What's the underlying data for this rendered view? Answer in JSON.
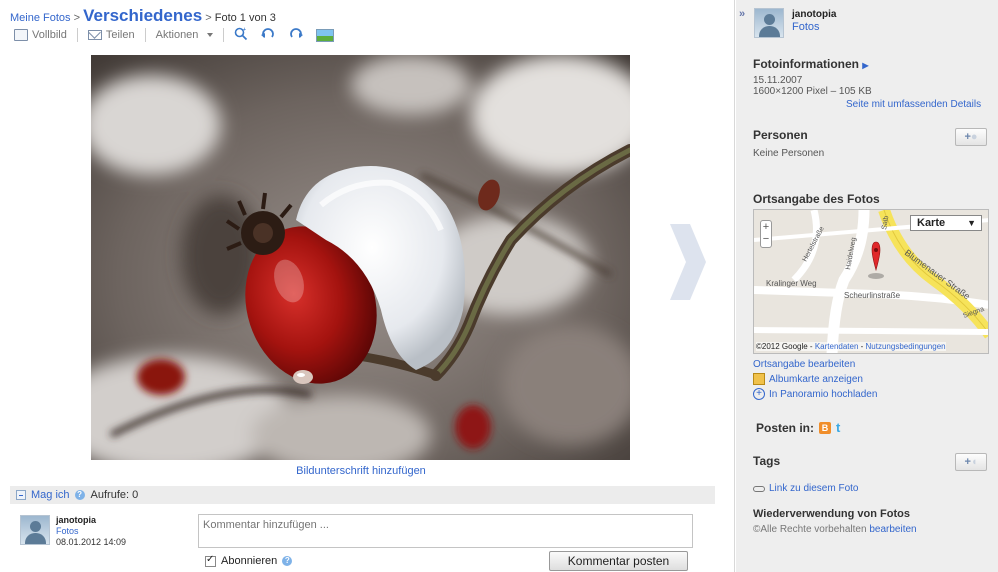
{
  "breadcrumb": {
    "root": "Meine Fotos",
    "sep1": ">",
    "album": "Verschiedenes",
    "sep2": ">",
    "position": "Foto 1 von 3"
  },
  "toolbar": {
    "fullscreen": "Vollbild",
    "share": "Teilen",
    "actions": "Aktionen"
  },
  "photo": {
    "caption_link": "Bildunterschrift hinzufügen"
  },
  "likebar": {
    "like": "Mag ich",
    "views": "Aufrufe: 0"
  },
  "comment": {
    "author": "janotopia",
    "author_link": "Fotos",
    "date": "08.01.2012 14:09",
    "placeholder": "Kommentar hinzufügen ...",
    "subscribe": "Abonnieren",
    "post_button": "Kommentar posten"
  },
  "sidebar": {
    "collapse": "»",
    "owner_name": "janotopia",
    "owner_link": "Fotos",
    "info_title": "Fotoinformationen",
    "info_date": "15.11.2007",
    "info_size": "1600×1200 Pixel – 105 KB",
    "info_details_link": "Seite mit umfassenden Details",
    "people_title": "Personen",
    "people_text": "Keine Personen",
    "people_add": "+",
    "location_title": "Ortsangabe des Fotos",
    "map_type": "Karte",
    "map_credit": "©2012 Google - ",
    "map_data_link": "Kartendaten",
    "map_terms_link": "Nutzungsbedingungen",
    "map_streets": [
      "Kralinger Weg",
      "Scheurlinstraße",
      "Blumenauer Straße",
      "Haidelweg",
      "Hertelstraße",
      "Salb",
      "Siegna"
    ],
    "edit_location": "Ortsangabe bearbeiten",
    "album_map": "Albumkarte anzeigen",
    "panoramio": "In Panoramio hochladen",
    "post_in": "Posten in:",
    "tags_title": "Tags",
    "tags_add": "+",
    "permalink": "Link zu diesem Foto",
    "reuse_title": "Wiederverwendung von Fotos",
    "reuse_text": "©Alle Rechte vorbehalten",
    "reuse_edit": "bearbeiten"
  }
}
